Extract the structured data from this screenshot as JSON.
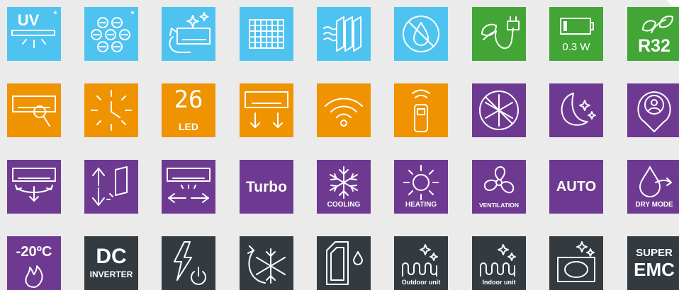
{
  "colors": {
    "blue": "#4fc3f0",
    "green": "#43a535",
    "orange": "#ef9300",
    "purple": "#6e3a91",
    "dark": "#333b40",
    "background": "#ebebeb"
  },
  "rows": [
    {
      "color": "mixed",
      "tiles": [
        {
          "icon": "uv-lamp-icon",
          "text": "UV",
          "asterisk": "*"
        },
        {
          "icon": "ion-filter-icon",
          "asterisk": "*"
        },
        {
          "icon": "self-cleaning-icon"
        },
        {
          "icon": "mesh-filter-icon"
        },
        {
          "icon": "multi-layer-filter-icon"
        },
        {
          "icon": "anti-mold-icon"
        },
        {
          "icon": "eco-plug-icon"
        },
        {
          "icon": "battery-icon",
          "text": "0.3 W"
        },
        {
          "icon": "eco-leaf-icon",
          "text": "R32"
        }
      ]
    },
    {
      "color": "orange-purple",
      "tiles": [
        {
          "icon": "self-diagnosis-icon"
        },
        {
          "icon": "timer-clock-icon"
        },
        {
          "icon": "led-display-icon",
          "text": "26",
          "sub": "LED"
        },
        {
          "icon": "airflow-down-icon"
        },
        {
          "icon": "wifi-icon"
        },
        {
          "icon": "remote-control-icon"
        },
        {
          "icon": "anti-frost-icon"
        },
        {
          "icon": "sleep-mode-icon"
        },
        {
          "icon": "i-feel-icon"
        }
      ]
    },
    {
      "color": "purple",
      "tiles": [
        {
          "icon": "3d-airflow-icon"
        },
        {
          "icon": "vertical-swing-icon"
        },
        {
          "icon": "horizontal-swing-icon"
        },
        {
          "icon": "turbo-icon",
          "text": "Turbo"
        },
        {
          "icon": "snowflake-icon",
          "label": "COOLING"
        },
        {
          "icon": "sun-icon",
          "label": "HEATING"
        },
        {
          "icon": "fan-icon",
          "label": "VENTILATION"
        },
        {
          "icon": "auto-icon",
          "text": "AUTO"
        },
        {
          "icon": "drop-icon",
          "label": "DRY MODE"
        }
      ]
    },
    {
      "color": "dark",
      "tiles": [
        {
          "icon": "flame-icon",
          "text": "-20ºC"
        },
        {
          "icon": "dc-inverter-icon",
          "text": "DC",
          "sub": "INVERTER"
        },
        {
          "icon": "power-surge-icon"
        },
        {
          "icon": "freeze-clean-icon"
        },
        {
          "icon": "hydrophilic-fin-icon"
        },
        {
          "icon": "heater-coil-icon",
          "label": "Outdoor unit"
        },
        {
          "icon": "heater-coil-icon",
          "label": "Indoor unit"
        },
        {
          "icon": "clean-panel-icon"
        },
        {
          "icon": "super-emc-icon",
          "text": "SUPER",
          "sub": "EMC"
        }
      ]
    }
  ]
}
